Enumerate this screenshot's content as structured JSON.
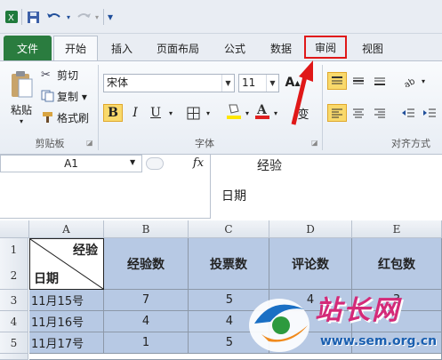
{
  "qat": {
    "save_icon": "floppy-disk-icon",
    "undo_icon": "undo-icon",
    "redo_icon": "redo-icon",
    "customize_symbol": "▾"
  },
  "tabs": [
    {
      "label": "文件"
    },
    {
      "label": "开始"
    },
    {
      "label": "插入"
    },
    {
      "label": "页面布局"
    },
    {
      "label": "公式"
    },
    {
      "label": "数据"
    },
    {
      "label": "审阅"
    },
    {
      "label": "视图"
    }
  ],
  "ribbon": {
    "clipboard": {
      "paste": "粘贴",
      "cut": "剪切",
      "copy": "复制 ▾",
      "format_painter": "格式刷",
      "group": "剪贴板"
    },
    "font": {
      "name": "宋体",
      "size": "11",
      "group": "字体",
      "bold": "B",
      "italic": "I",
      "underline": "U",
      "wen": "变"
    },
    "alignment": {
      "group": "对齐方式"
    }
  },
  "formula_bar": {
    "name_box": "A1",
    "fx": "fx",
    "line1": "经验",
    "line2": "日期"
  },
  "sheet": {
    "columns": [
      "A",
      "B",
      "C",
      "D",
      "E"
    ],
    "rows": [
      "1",
      "2",
      "3",
      "4",
      "5"
    ],
    "a1_top": "经验",
    "a1_bottom": "日期",
    "headers": [
      "经验数",
      "投票数",
      "评论数",
      "红包数"
    ],
    "data": [
      {
        "date": "11月15号",
        "b": "7",
        "c": "5",
        "d": "4",
        "e": "3"
      },
      {
        "date": "11月16号",
        "b": "4",
        "c": "4",
        "d": "",
        "e": ""
      },
      {
        "date": "11月17号",
        "b": "1",
        "c": "5",
        "d": "",
        "e": ""
      }
    ]
  },
  "watermark": {
    "brand": "站长网",
    "url": "www.sem.org.cn"
  },
  "colors": {
    "file_tab": "#2a7c3f",
    "highlight": "#e01818",
    "cell_blue": "#b7c9e4"
  }
}
